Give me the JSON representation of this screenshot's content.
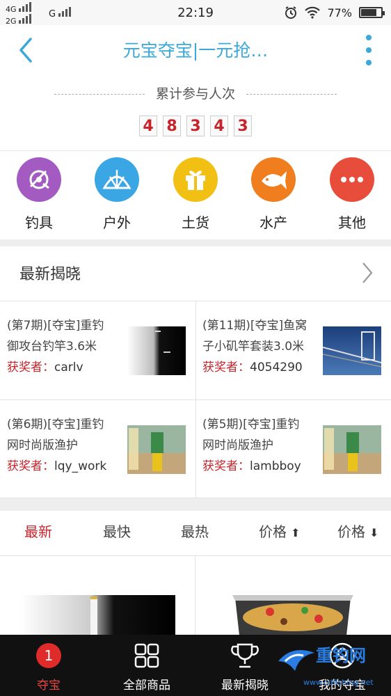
{
  "status_bar": {
    "net_top": "4G",
    "net_bottom": "2G",
    "net_g": "G",
    "time": "22:19",
    "battery": "77%",
    "battery_level": 0.77
  },
  "header": {
    "title": "元宝夺宝|一元抢…"
  },
  "participants": {
    "label": "累计参与人次",
    "digits": [
      "4",
      "8",
      "3",
      "4",
      "3"
    ]
  },
  "categories": [
    {
      "label": "钓具",
      "icon": "fishing-reel-icon",
      "color": "#a35bc2"
    },
    {
      "label": "户外",
      "icon": "tent-icon",
      "color": "#3aa6e4"
    },
    {
      "label": "土货",
      "icon": "gift-icon",
      "color": "#f2c012"
    },
    {
      "label": "水产",
      "icon": "fish-icon",
      "color": "#f07e1e"
    },
    {
      "label": "其他",
      "icon": "more-dots-icon",
      "color": "#e84d3c"
    }
  ],
  "latest": {
    "title": "最新揭晓",
    "winner_label": "获奖者：",
    "items": [
      {
        "line1": "(第7期)[夺宝]重钓",
        "line2": "御攻台钓竿3.6米",
        "winner": "carlv"
      },
      {
        "line1": "(第11期)[夺宝]鱼窝",
        "line2": "子小矶竿套装3.0米",
        "winner": "4054290"
      },
      {
        "line1": "(第6期)[夺宝]重钓",
        "line2": "网时尚版渔护",
        "winner": "lqy_work"
      },
      {
        "line1": "(第5期)[夺宝]重钓",
        "line2": "网时尚版渔护",
        "winner": "lambboy"
      }
    ]
  },
  "sort_tabs": [
    "最新",
    "最快",
    "最热",
    "价格",
    "价格"
  ],
  "nav": {
    "badge": "1",
    "items": [
      "夺宝",
      "全部商品",
      "最新揭晓",
      "我的夺宝"
    ]
  },
  "watermark": {
    "text": "重钓网",
    "url": "www.cdfishing.net"
  },
  "colors": {
    "accent": "#3aa8d8",
    "red": "#c8242b"
  }
}
